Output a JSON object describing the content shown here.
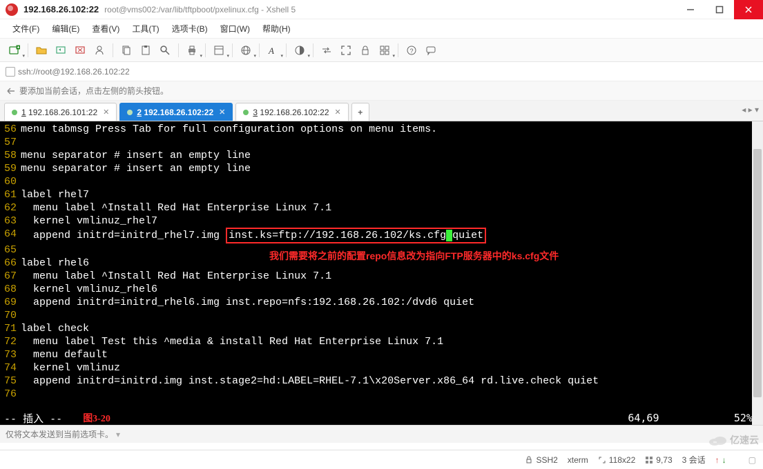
{
  "window": {
    "title": "192.168.26.102:22",
    "subtitle": "root@vms002:/var/lib/tftpboot/pxelinux.cfg - Xshell 5"
  },
  "menu": {
    "file": "文件(F)",
    "edit": "编辑(E)",
    "view": "查看(V)",
    "tools": "工具(T)",
    "tabs": "选项卡(B)",
    "window": "窗口(W)",
    "help": "帮助(H)"
  },
  "address": "ssh://root@192.168.26.102:22",
  "hint": "要添加当前会话，点击左侧的箭头按钮。",
  "tabs": [
    {
      "num": "1",
      "label": "192.168.26.101:22",
      "active": false
    },
    {
      "num": "2",
      "label": "192.168.26.102:22",
      "active": true
    },
    {
      "num": "3",
      "label": "192.168.26.102:22",
      "active": false
    }
  ],
  "terminal": {
    "lines": [
      {
        "n": "56",
        "t": "menu tabmsg Press Tab for full configuration options on menu items."
      },
      {
        "n": "57",
        "t": ""
      },
      {
        "n": "58",
        "t": "menu separator # insert an empty line"
      },
      {
        "n": "59",
        "t": "menu separator # insert an empty line"
      },
      {
        "n": "60",
        "t": ""
      },
      {
        "n": "61",
        "t": "label rhel7"
      },
      {
        "n": "62",
        "t": "  menu label ^Install Red Hat Enterprise Linux 7.1"
      },
      {
        "n": "63",
        "t": "  kernel vmlinuz_rhel7"
      },
      {
        "n": "64",
        "pre": "  append initrd=initrd_rhel7.img ",
        "box": "inst.ks=ftp://192.168.26.102/ks.cfg",
        "cursor": " ",
        "post": "quiet"
      },
      {
        "n": "65",
        "t": ""
      },
      {
        "n": "66",
        "t": "label rhel6"
      },
      {
        "n": "67",
        "t": "  menu label ^Install Red Hat Enterprise Linux 7.1"
      },
      {
        "n": "68",
        "t": "  kernel vmlinuz_rhel6"
      },
      {
        "n": "69",
        "t": "  append initrd=initrd_rhel6.img inst.repo=nfs:192.168.26.102:/dvd6 quiet"
      },
      {
        "n": "70",
        "t": ""
      },
      {
        "n": "71",
        "t": "label check"
      },
      {
        "n": "72",
        "t": "  menu label Test this ^media & install Red Hat Enterprise Linux 7.1"
      },
      {
        "n": "73",
        "t": "  menu default"
      },
      {
        "n": "74",
        "t": "  kernel vmlinuz"
      },
      {
        "n": "75",
        "t": "  append initrd=initrd.img inst.stage2=hd:LABEL=RHEL-7.1\\x20Server.x86_64 rd.live.check quiet"
      },
      {
        "n": "76",
        "t": ""
      }
    ],
    "annotation": "我们需要将之前的配置repo信息改为指向FTP服务器中的ks.cfg文件",
    "mode": "-- 插入 --",
    "fig": "图3-20",
    "pos": "64,69",
    "pct": "52%"
  },
  "bottom_hint": "仅将文本发送到当前选项卡。",
  "status": {
    "proto": "SSH2",
    "term": "xterm",
    "size": "118x22",
    "cursor": "9,73",
    "sessions_label": "3 会话",
    "watermark": "亿速云"
  }
}
